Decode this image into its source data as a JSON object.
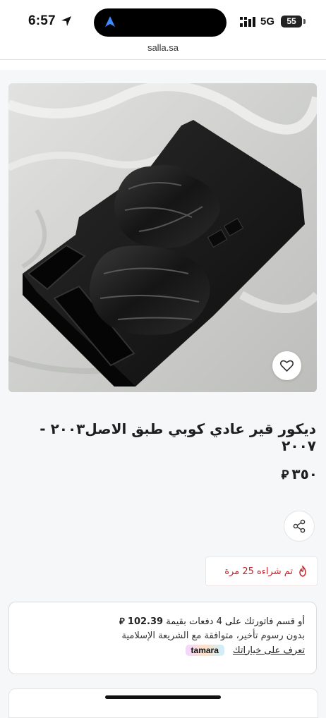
{
  "status_bar": {
    "time": "6:57",
    "network": "5G",
    "battery": "55"
  },
  "browser": {
    "url": "salla.sa"
  },
  "product": {
    "image_icon": "product-photo",
    "title": "ديكور قير عادي كوبي طبق الاصل٢٠٠٣ - ٢٠٠٧",
    "price": "٣٥٠",
    "currency_icon": "riyal-symbol",
    "sold_text": "تم شراءه 25 مرة"
  },
  "tamara": {
    "line1_prefix": "أو قسم فاتورتك على 4 دفعات بقيمة",
    "installment_amount": "102.39",
    "line2": "بدون رسوم تأخير، متوافقة مع الشريعة الإسلامية",
    "learn_more": "تعرف على خياراتك",
    "logo": "tamara"
  },
  "colors": {
    "accent_red": "#c4242b",
    "page_bg": "#f6f7f9"
  }
}
